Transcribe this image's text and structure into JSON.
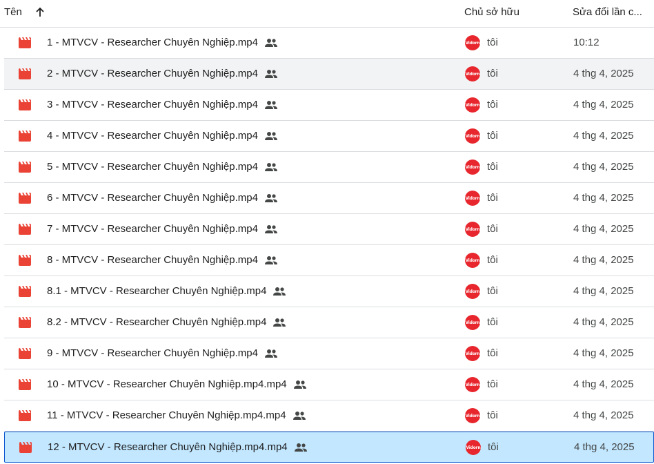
{
  "header": {
    "name_label": "Tên",
    "owner_label": "Chủ sở hữu",
    "modified_label": "Sửa đổi lần c..."
  },
  "colors": {
    "video_icon": "#ea4335",
    "avatar_bg": "#e8262d",
    "selected_bg": "#c2e7ff",
    "hover_bg": "#f1f3f4"
  },
  "avatar_text": "Vidorn",
  "rows": [
    {
      "name": "1 - MTVCV - Researcher Chuyên Nghiệp.mp4",
      "owner": "tôi",
      "modified": "10:12"
    },
    {
      "name": "2 - MTVCV - Researcher Chuyên Nghiệp.mp4",
      "owner": "tôi",
      "modified": "4 thg 4, 2025"
    },
    {
      "name": "3 - MTVCV - Researcher Chuyên Nghiệp.mp4",
      "owner": "tôi",
      "modified": "4 thg 4, 2025"
    },
    {
      "name": "4 - MTVCV - Researcher Chuyên Nghiệp.mp4",
      "owner": "tôi",
      "modified": "4 thg 4, 2025"
    },
    {
      "name": "5 - MTVCV - Researcher Chuyên Nghiệp.mp4",
      "owner": "tôi",
      "modified": "4 thg 4, 2025"
    },
    {
      "name": "6 - MTVCV - Researcher Chuyên Nghiệp.mp4",
      "owner": "tôi",
      "modified": "4 thg 4, 2025"
    },
    {
      "name": "7 - MTVCV - Researcher Chuyên Nghiệp.mp4",
      "owner": "tôi",
      "modified": "4 thg 4, 2025"
    },
    {
      "name": "8 - MTVCV - Researcher Chuyên Nghiệp.mp4",
      "owner": "tôi",
      "modified": "4 thg 4, 2025"
    },
    {
      "name": "8.1 - MTVCV - Researcher Chuyên Nghiệp.mp4",
      "owner": "tôi",
      "modified": "4 thg 4, 2025"
    },
    {
      "name": "8.2 - MTVCV - Researcher Chuyên Nghiệp.mp4",
      "owner": "tôi",
      "modified": "4 thg 4, 2025"
    },
    {
      "name": "9 - MTVCV - Researcher Chuyên Nghiệp.mp4",
      "owner": "tôi",
      "modified": "4 thg 4, 2025"
    },
    {
      "name": "10 - MTVCV - Researcher Chuyên Nghiệp.mp4.mp4",
      "owner": "tôi",
      "modified": "4 thg 4, 2025"
    },
    {
      "name": "11 - MTVCV - Researcher Chuyên Nghiệp.mp4.mp4",
      "owner": "tôi",
      "modified": "4 thg 4, 2025"
    },
    {
      "name": "12 - MTVCV - Researcher Chuyên Nghiệp.mp4.mp4",
      "owner": "tôi",
      "modified": "4 thg 4, 2025"
    }
  ]
}
